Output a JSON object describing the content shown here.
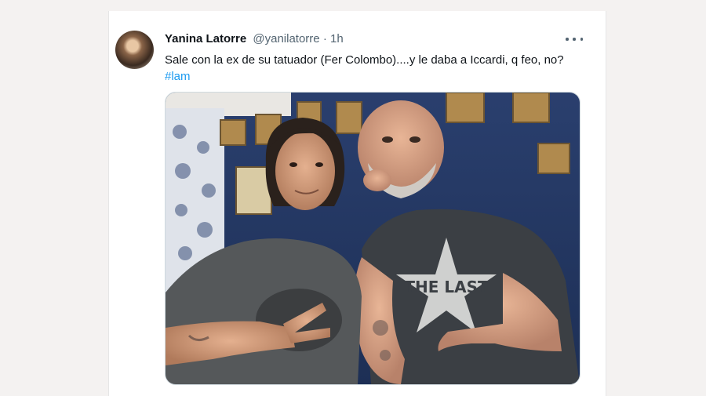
{
  "tweet": {
    "author_name": "Yanina Latorre",
    "handle": "@yanilatorre",
    "separator": "·",
    "time": "1h",
    "text": "Sale con la ex de su tatuador (Fer Colombo)....y le daba a Iccardi, q feo, no?",
    "hashtag": "#lam",
    "shirt_text": "THE LAST"
  },
  "colors": {
    "link": "#1d9bf0",
    "text": "#0f1419",
    "secondary": "#536471"
  }
}
